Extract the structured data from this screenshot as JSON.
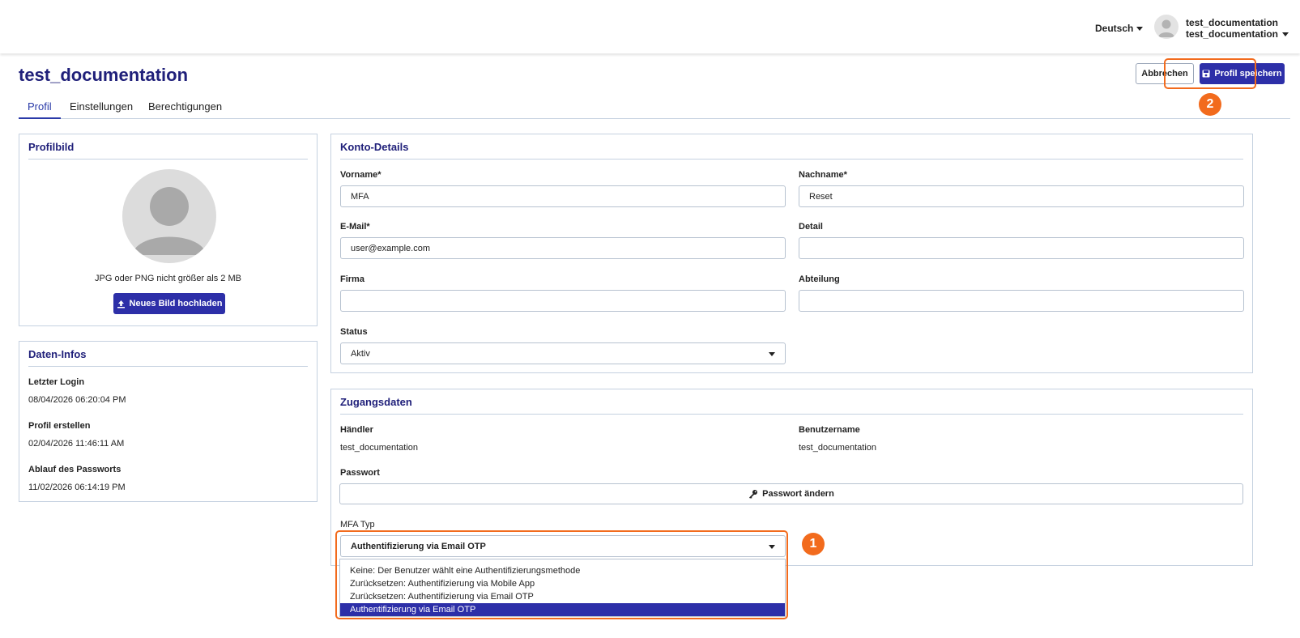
{
  "header": {
    "language": "Deutsch",
    "user_line1": "test_documentation",
    "user_line2": "test_documentation"
  },
  "page": {
    "title": "test_documentation",
    "tabs": [
      {
        "label": "Profil",
        "active": true
      },
      {
        "label": "Einstellungen",
        "active": false
      },
      {
        "label": "Berechtigungen",
        "active": false
      }
    ],
    "cancel_label": "Abbrechen",
    "save_label": "Profil speichern"
  },
  "profile_picture": {
    "title": "Profilbild",
    "hint": "JPG oder PNG nicht größer als 2 MB",
    "upload_label": "Neues Bild hochladen"
  },
  "data_info": {
    "title": "Daten-Infos",
    "last_login_label": "Letzter Login",
    "last_login_value": "08/04/2026 06:20:04 PM",
    "created_label": "Profil erstellen",
    "created_value": "02/04/2026 11:46:11 AM",
    "pw_expiry_label": "Ablauf des Passworts",
    "pw_expiry_value": "11/02/2026 06:14:19 PM"
  },
  "account": {
    "title": "Konto-Details",
    "first_name_label": "Vorname*",
    "first_name_value": "MFA",
    "last_name_label": "Nachname*",
    "last_name_value": "Reset",
    "email_label": "E-Mail*",
    "email_value": "user@example.com",
    "detail_label": "Detail",
    "detail_value": "",
    "company_label": "Firma",
    "company_value": "",
    "department_label": "Abteilung",
    "department_value": "",
    "status_label": "Status",
    "status_value": "Aktiv"
  },
  "access": {
    "title": "Zugangsdaten",
    "dealer_label": "Händler",
    "dealer_value": "test_documentation",
    "username_label": "Benutzername",
    "username_value": "test_documentation",
    "password_label": "Passwort",
    "change_password_label": "Passwort ändern",
    "mfa_label": "MFA Typ",
    "mfa_value": "Authentifizierung via Email OTP",
    "mfa_options": [
      "Keine: Der Benutzer wählt eine Authentifizierungsmethode",
      "Zurücksetzen: Authentifizierung via Mobile App",
      "Zurücksetzen: Authentifizierung via Email OTP",
      "Authentifizierung via Email OTP"
    ],
    "mfa_selected_index": 3
  },
  "annotations": {
    "badge1": "1",
    "badge2": "2",
    "color": "#f26b1d"
  },
  "colors": {
    "primary": "#2d2fa8",
    "title": "#20207a",
    "border": "#c5d1e0"
  }
}
